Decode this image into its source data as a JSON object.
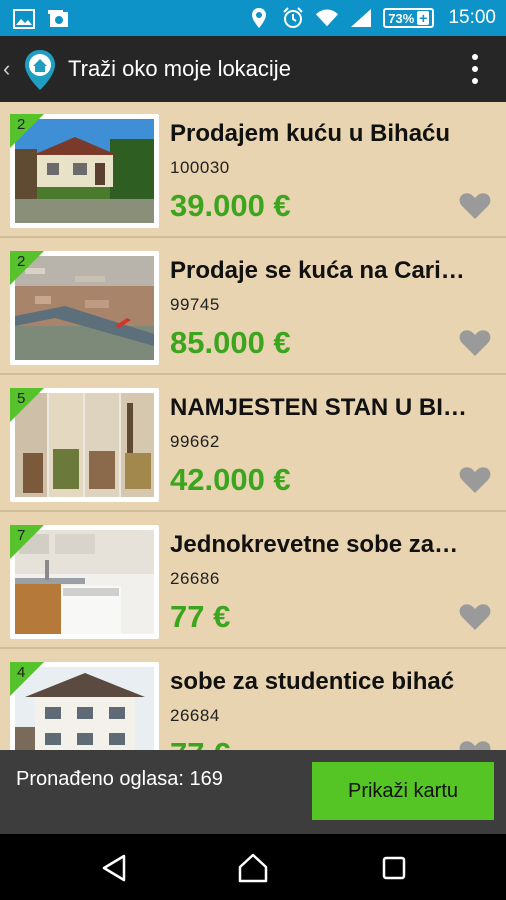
{
  "status_bar": {
    "battery": "73%",
    "time": "15:00"
  },
  "app_bar": {
    "title": "Traži oko moje lokacije"
  },
  "listings": [
    {
      "badge": "2",
      "title": "Prodajem kuću u Bihaću",
      "id": "100030",
      "price": "39.000 €",
      "thumb": "house"
    },
    {
      "badge": "2",
      "title": "Prodaje se kuća na Cari…",
      "id": "99745",
      "price": "85.000 €",
      "thumb": "aerial"
    },
    {
      "badge": "5",
      "title": "NAMJESTEN STAN U BI…",
      "id": "99662",
      "price": "42.000 €",
      "thumb": "rooms"
    },
    {
      "badge": "7",
      "title": "Jednokrevetne sobe za…",
      "id": "26686",
      "price": "77 €",
      "thumb": "kitchen"
    },
    {
      "badge": "4",
      "title": "sobe za studentice bihać",
      "id": "26684",
      "price": "77 €",
      "thumb": "building"
    }
  ],
  "footer": {
    "found_label": "Pronađeno oglasa: 169",
    "map_button": "Prikaži kartu"
  },
  "colors": {
    "status_bar": "#0e93c8",
    "app_bar": "#262626",
    "list_bg": "#e8d4b0",
    "price": "#3ba51e",
    "badge": "#56c22c",
    "button": "#55c526"
  },
  "icons": [
    "image-icon",
    "camera-icon",
    "location-icon",
    "alarm-icon",
    "wifi-icon",
    "signal-icon",
    "battery-icon",
    "app-logo-icon",
    "overflow-menu-icon",
    "heart-icon",
    "back-nav-icon",
    "home-nav-icon",
    "recents-nav-icon"
  ]
}
